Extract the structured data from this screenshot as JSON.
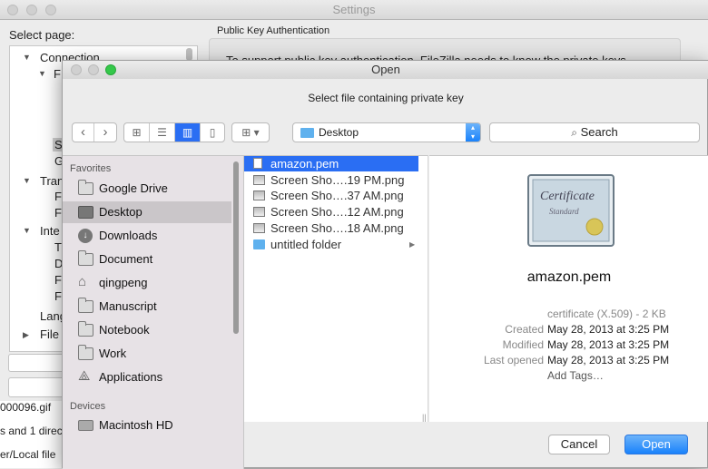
{
  "settings": {
    "title": "Settings",
    "select_page": "Select page:",
    "section_title": "Public Key Authentication",
    "body_text": "To support public key authentication, FileZilla needs to know the private keys",
    "tree": [
      {
        "label": "Connection",
        "level": 1,
        "expanded": true
      },
      {
        "label": "F",
        "level": 2,
        "expanded": true
      },
      {
        "label": "S",
        "level": 3
      },
      {
        "label": "G",
        "level": 3
      },
      {
        "label": "Tran",
        "level": 1,
        "expanded": true
      },
      {
        "label": "Fi",
        "level": 2
      },
      {
        "label": "Fi",
        "level": 2
      },
      {
        "label": "Inte",
        "level": 1,
        "expanded": true
      },
      {
        "label": "Th",
        "level": 2
      },
      {
        "label": "D",
        "level": 2
      },
      {
        "label": "Fi",
        "level": 2
      },
      {
        "label": "Fi",
        "level": 2
      },
      {
        "label": "Lang",
        "level": 1
      },
      {
        "label": "File",
        "level": 1
      }
    ],
    "bottom_text_1": "000096.gif",
    "bottom_text_2": "s and 1 direc",
    "bottom_text_3": "er/Local file"
  },
  "dialog": {
    "title": "Open",
    "prompt": "Select file containing private key",
    "location": "Desktop",
    "search_label": "Search",
    "favorites_header": "Favorites",
    "devices_header": "Devices",
    "device_partial": "Macintosh HD",
    "favorites": [
      {
        "label": "Google Drive",
        "icon": "folder-icon"
      },
      {
        "label": "Desktop",
        "icon": "desktop-icon",
        "selected": true
      },
      {
        "label": "Downloads",
        "icon": "downloads-icon"
      },
      {
        "label": "Document",
        "icon": "folder-icon"
      },
      {
        "label": "qingpeng",
        "icon": "home-icon"
      },
      {
        "label": "Manuscript",
        "icon": "folder-icon"
      },
      {
        "label": "Notebook",
        "icon": "folder-icon"
      },
      {
        "label": "Work",
        "icon": "folder-icon"
      },
      {
        "label": "Applications",
        "icon": "applications-icon"
      }
    ],
    "files": [
      {
        "name": "amazon.pem",
        "icon": "document-icon",
        "selected": true
      },
      {
        "name": "Screen Sho….19 PM.png",
        "icon": "image-icon"
      },
      {
        "name": "Screen Sho….37 AM.png",
        "icon": "image-icon"
      },
      {
        "name": "Screen Sho….12 AM.png",
        "icon": "image-icon"
      },
      {
        "name": "Screen Sho….18 AM.png",
        "icon": "image-icon"
      },
      {
        "name": "untitled folder",
        "icon": "folder-icon",
        "has_children": true
      }
    ],
    "preview": {
      "name": "amazon.pem",
      "kind": "certificate (X.509) - 2 KB",
      "created_label": "Created",
      "created": "May 28, 2013 at 3:25 PM",
      "modified_label": "Modified",
      "modified": "May 28, 2013 at 3:25 PM",
      "opened_label": "Last opened",
      "opened": "May 28, 2013 at 3:25 PM",
      "add_tags": "Add Tags…",
      "cert_line1": "Certificate",
      "cert_line2": "Standard"
    },
    "cancel_label": "Cancel",
    "open_label": "Open",
    "colors": {
      "accent": "#2a6ef3",
      "selection": "#cac6c9",
      "close": "#fc605c",
      "minimize": "#fdbc40",
      "zoom": "#34c84a"
    }
  }
}
